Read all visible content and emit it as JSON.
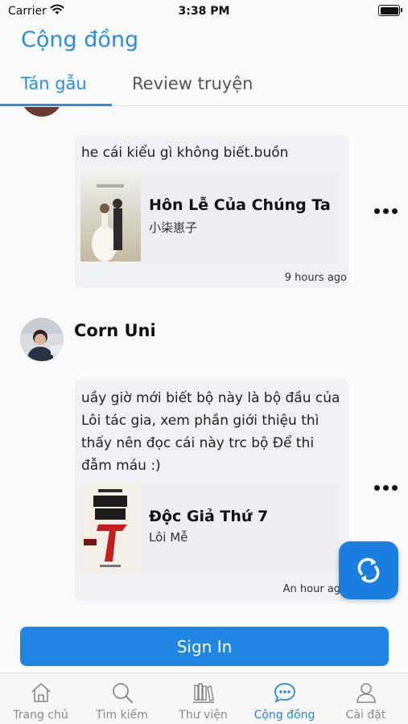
{
  "status_bar": {
    "carrier": "Carrier",
    "time": "3:38 PM",
    "battery_level": 1.0
  },
  "header": {
    "title": "Cộng đồng"
  },
  "tabs": [
    {
      "label": "Tán gẫu",
      "active": true
    },
    {
      "label": "Review truyện",
      "active": false
    }
  ],
  "posts": [
    {
      "text": "he cái kiểu gì không biết.buồn",
      "book": {
        "title": "Hôn Lễ Của Chúng Ta",
        "author": "小柒崽子"
      },
      "time": "9 hours ago"
    },
    {
      "user": "Corn Uni",
      "text": "uầy giờ mới biết bộ này là bộ đầu của Lôi tác gia, xem phần giới thiệu thì thấy nên đọc cái này trc bộ Để thi đẫm máu :)",
      "book": {
        "title": "Độc Giả Thứ 7",
        "author": "Lôi Mễ"
      },
      "time": "An hour ago"
    }
  ],
  "sign_in_label": "Sign In",
  "nav": [
    {
      "label": "Trang chủ",
      "icon": "home-icon",
      "active": false
    },
    {
      "label": "Tìm kiếm",
      "icon": "search-icon",
      "active": false
    },
    {
      "label": "Thư viện",
      "icon": "library-icon",
      "active": false
    },
    {
      "label": "Cộng đồng",
      "icon": "chat-icon",
      "active": true
    },
    {
      "label": "Cài đặt",
      "icon": "user-icon",
      "active": false
    }
  ],
  "colors": {
    "accent": "#2a8de3",
    "fab": "#1a7fe0",
    "text": "#111111",
    "inactive": "#8a8a8a"
  }
}
